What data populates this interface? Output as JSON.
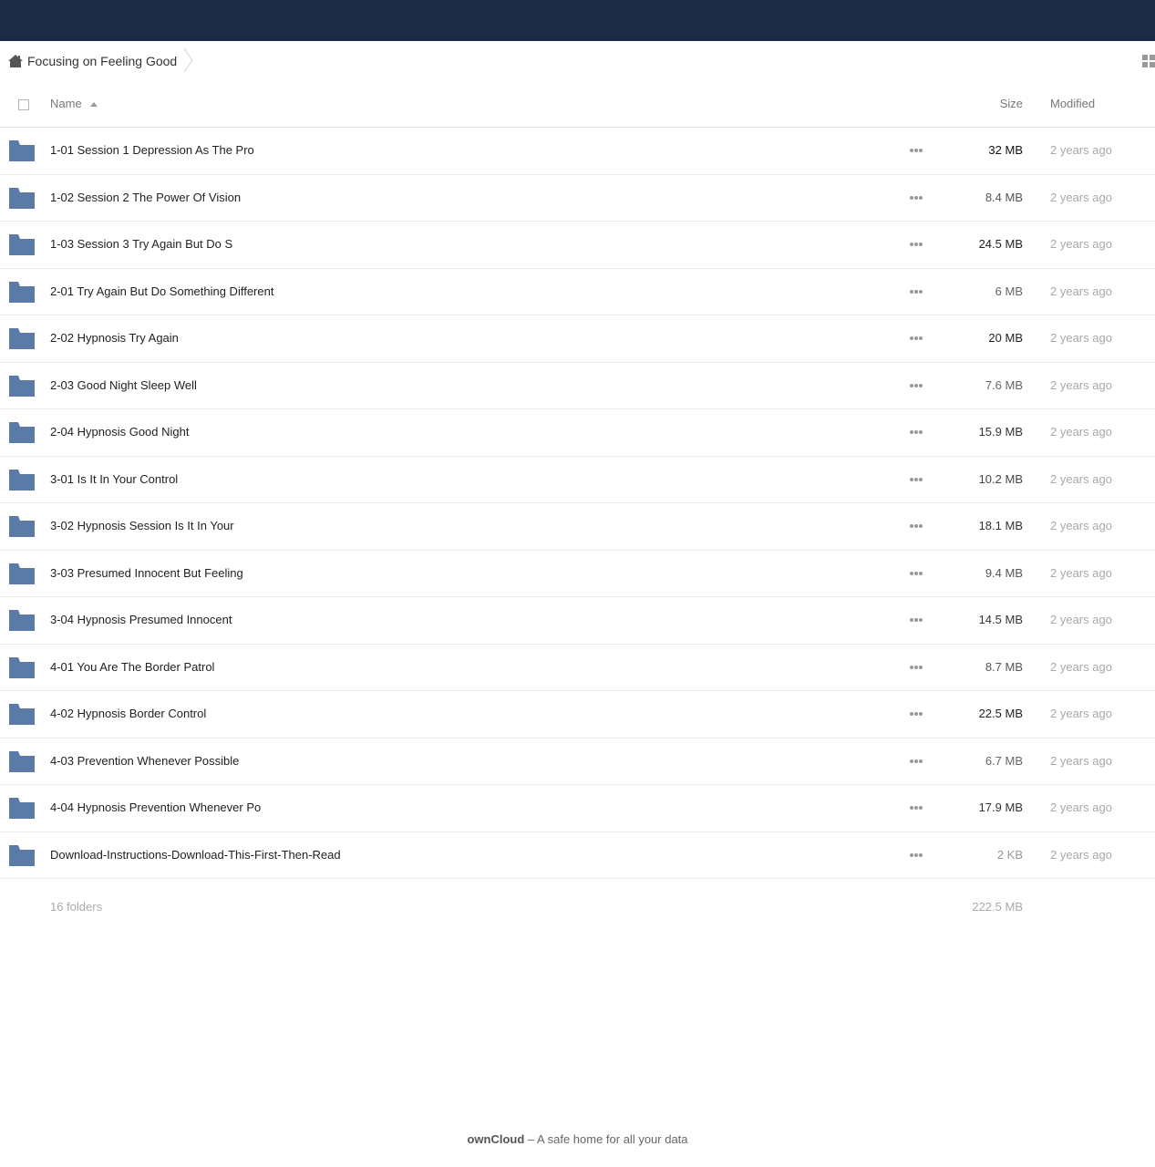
{
  "breadcrumb": {
    "current": "Focusing on Feeling Good"
  },
  "header": {
    "name_label": "Name",
    "size_label": "Size",
    "modified_label": "Modified"
  },
  "files": [
    {
      "name": "1-01 Session 1 Depression As The Pro",
      "size": "32 MB",
      "size_color": "#111111",
      "modified": "2 years ago"
    },
    {
      "name": "1-02 Session 2 The Power Of Vision",
      "size": "8.4 MB",
      "size_color": "#555555",
      "modified": "2 years ago"
    },
    {
      "name": "1-03 Session 3 Try Again But Do S",
      "size": "24.5 MB",
      "size_color": "#222222",
      "modified": "2 years ago"
    },
    {
      "name": "2-01 Try Again But Do Something Different",
      "size": "6 MB",
      "size_color": "#666666",
      "modified": "2 years ago"
    },
    {
      "name": "2-02 Hypnosis Try Again",
      "size": "20 MB",
      "size_color": "#222222",
      "modified": "2 years ago"
    },
    {
      "name": "2-03 Good Night Sleep Well",
      "size": "7.6 MB",
      "size_color": "#666666",
      "modified": "2 years ago"
    },
    {
      "name": "2-04 Hypnosis Good Night",
      "size": "15.9 MB",
      "size_color": "#333333",
      "modified": "2 years ago"
    },
    {
      "name": "3-01 Is It In Your Control",
      "size": "10.2 MB",
      "size_color": "#444444",
      "modified": "2 years ago"
    },
    {
      "name": "3-02 Hypnosis Session Is It In Your",
      "size": "18.1 MB",
      "size_color": "#333333",
      "modified": "2 years ago"
    },
    {
      "name": "3-03 Presumed Innocent But Feeling",
      "size": "9.4 MB",
      "size_color": "#555555",
      "modified": "2 years ago"
    },
    {
      "name": "3-04 Hypnosis Presumed Innocent",
      "size": "14.5 MB",
      "size_color": "#333333",
      "modified": "2 years ago"
    },
    {
      "name": "4-01 You Are The Border Patrol",
      "size": "8.7 MB",
      "size_color": "#555555",
      "modified": "2 years ago"
    },
    {
      "name": "4-02 Hypnosis Border Control",
      "size": "22.5 MB",
      "size_color": "#222222",
      "modified": "2 years ago"
    },
    {
      "name": "4-03 Prevention Whenever Possible",
      "size": "6.7 MB",
      "size_color": "#666666",
      "modified": "2 years ago"
    },
    {
      "name": "4-04 Hypnosis Prevention Whenever Po",
      "size": "17.9 MB",
      "size_color": "#333333",
      "modified": "2 years ago"
    },
    {
      "name": "Download-Instructions-Download-This-First-Then-Read",
      "size": "2 KB",
      "size_color": "#999999",
      "modified": "2 years ago"
    }
  ],
  "summary": {
    "count": "16 folders",
    "total_size": "222.5 MB"
  },
  "footer": {
    "brand": "ownCloud",
    "tagline": " – A safe home for all your data"
  },
  "colors": {
    "topbar": "#1d2a44",
    "folder": "#5b7aa6"
  },
  "icons": {
    "home": "home-icon",
    "folder": "folder-icon",
    "more": "more-actions-icon",
    "view_toggle": "grid-view-icon"
  }
}
